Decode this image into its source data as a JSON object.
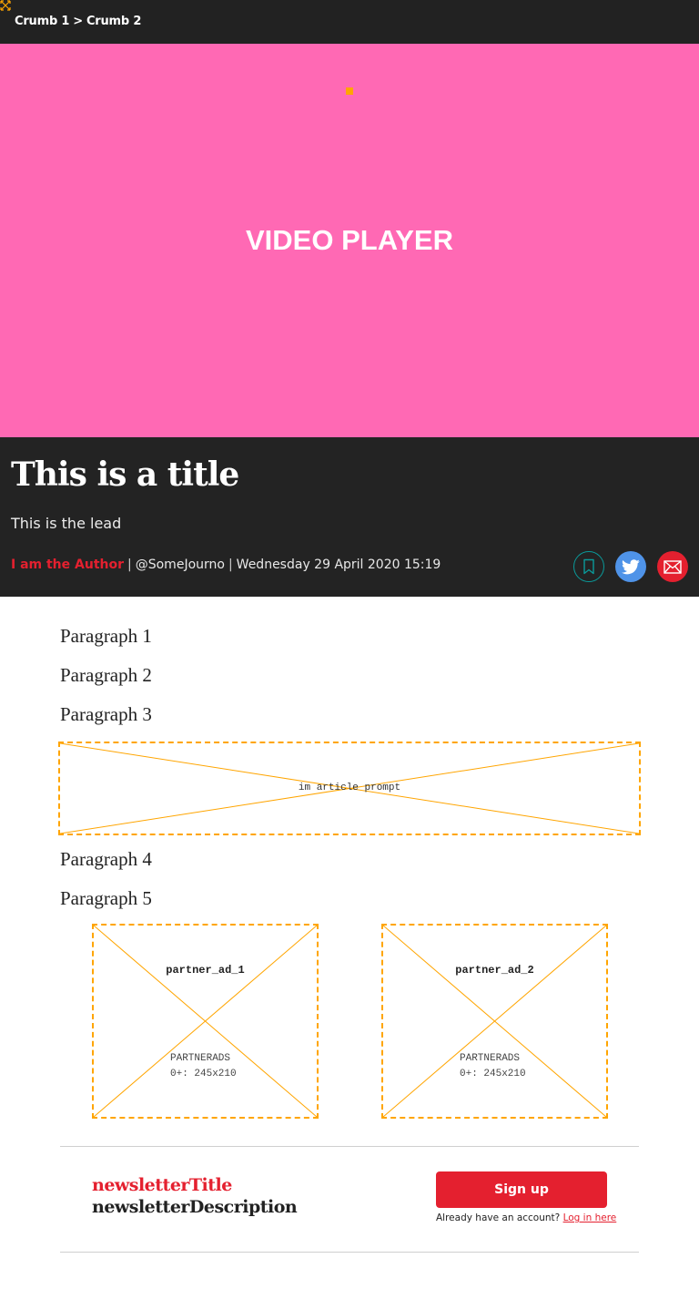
{
  "breadcrumb": {
    "items": [
      "Crumb 1",
      "Crumb 2"
    ],
    "separator": ">",
    "corner_icon": "resize-arrows-icon"
  },
  "video": {
    "label": "VIDEO PLAYER",
    "background": "#ff69b4",
    "indicator_color": "#ffa500"
  },
  "article": {
    "title": "This is a title",
    "lead": "This is the lead",
    "author": "I am the Author",
    "handle": "@SomeJourno",
    "date": "Wednesday 29 April 2020 15:19",
    "accent_color": "#e4202f",
    "header_background": "#232323",
    "actions": {
      "save_icon": "bookmark-icon",
      "twitter_icon": "twitter-icon",
      "email_icon": "email-icon",
      "twitter_color": "#4f93e8"
    },
    "paragraphs": [
      "Paragraph 1",
      "Paragraph 2",
      "Paragraph 3",
      "Paragraph 4",
      "Paragraph 5"
    ]
  },
  "ads": {
    "prompt": {
      "label": "im article prompt"
    },
    "partners": [
      {
        "name": "partner_ad_1",
        "line1": "PARTNERADS",
        "line2": "0+: 245x210"
      },
      {
        "name": "partner_ad_2",
        "line1": "PARTNERADS",
        "line2": "0+: 245x210"
      }
    ],
    "border_color": "#ffa500"
  },
  "newsletter": {
    "title": "newsletterTitle",
    "description": "newsletterDescription",
    "signup_label": "Sign up",
    "account_text": "Already have an account?",
    "login_label": "Log in here"
  }
}
